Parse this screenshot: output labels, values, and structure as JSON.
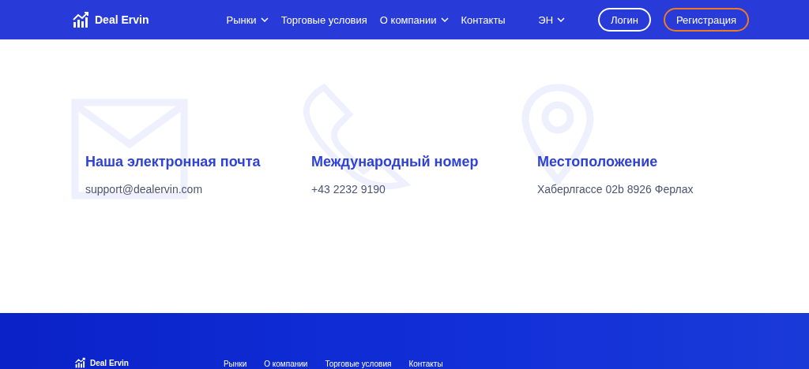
{
  "header": {
    "logo": "Deal Ervin",
    "nav": [
      {
        "label": "Рынки",
        "dropdown": true
      },
      {
        "label": "Торговые условия",
        "dropdown": false
      },
      {
        "label": "О компании",
        "dropdown": true
      },
      {
        "label": "Контакты",
        "dropdown": false
      }
    ],
    "language": "ЭН",
    "login": "Логин",
    "register": "Регистрация"
  },
  "contacts": [
    {
      "kind": "mail",
      "title": "Наша электронная почта",
      "value": "support@dealervin.com"
    },
    {
      "kind": "phone",
      "title": "Международный номер",
      "value": "+43 2232 9190"
    },
    {
      "kind": "location",
      "title": "Местоположение",
      "value": "Хаберлгассе 02b 8926 Ферлах"
    }
  ],
  "footer": {
    "logo": "Deal Ervin",
    "nav": [
      "Рынки",
      "О компании",
      "Торговые условия",
      "Контакты"
    ]
  }
}
